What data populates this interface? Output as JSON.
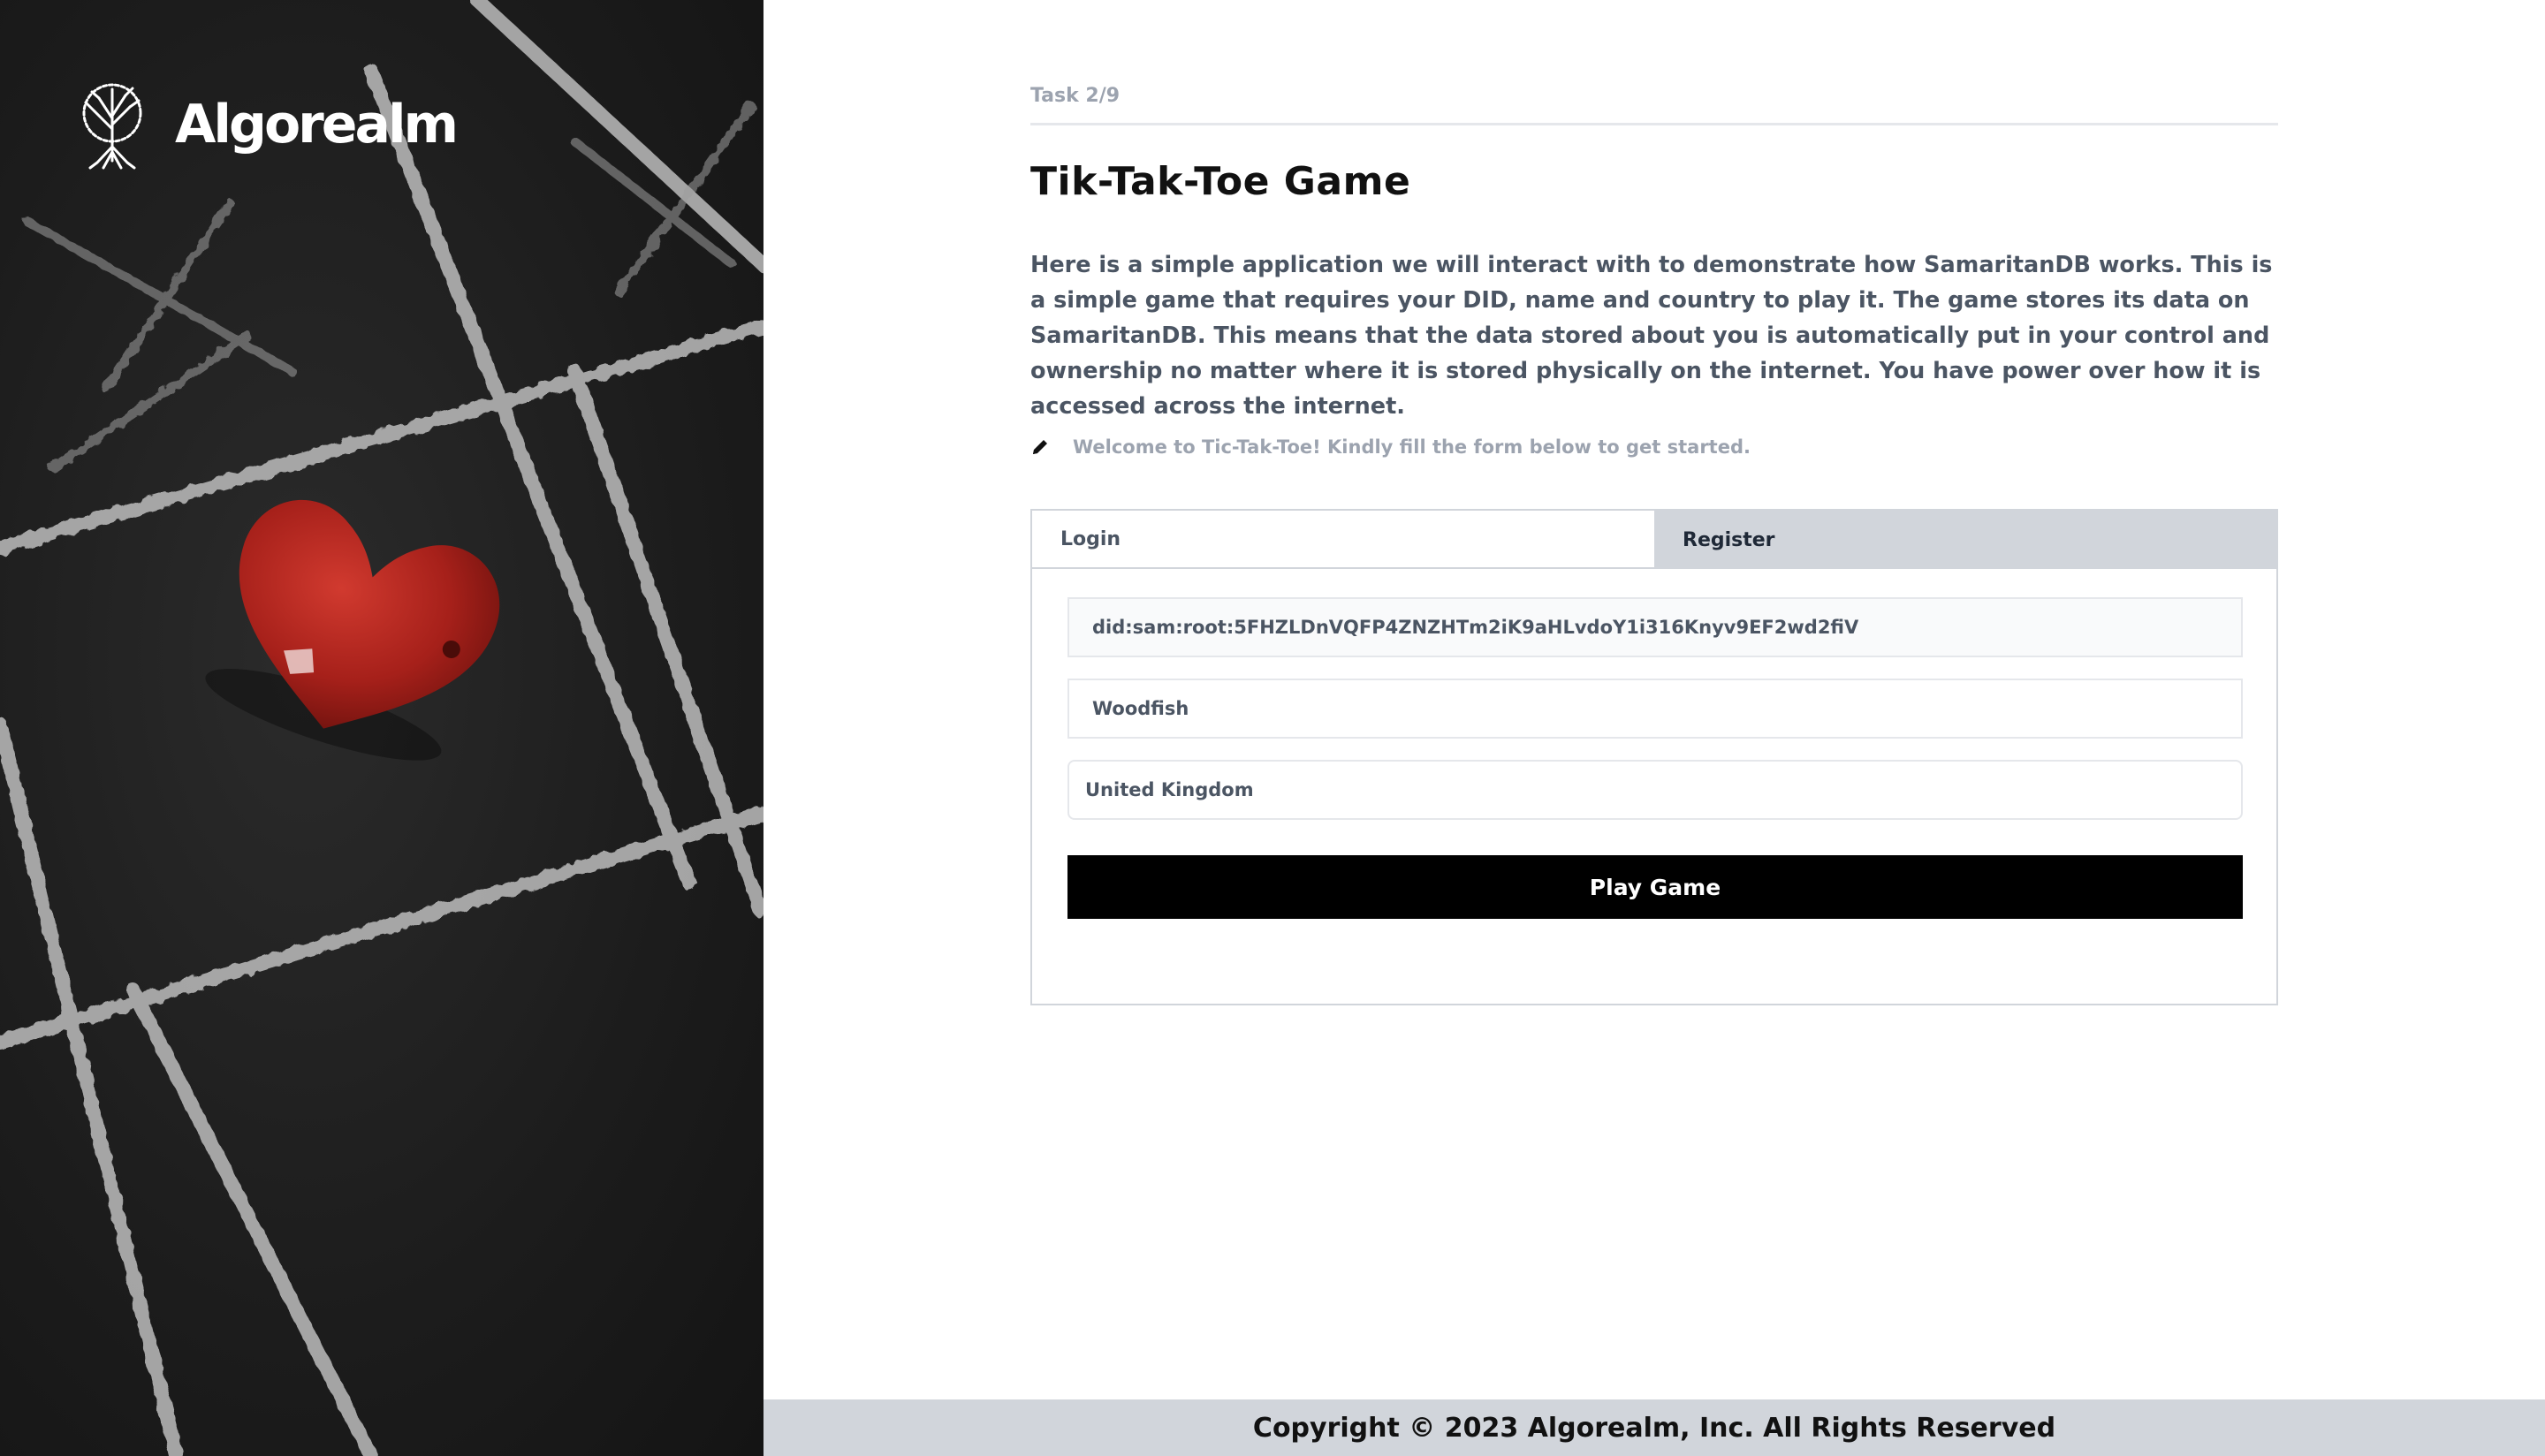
{
  "brand": {
    "name": "Algorealm",
    "logo_icon": "tree-icon"
  },
  "hero": {
    "image": "tic-tac-toe-chalk-board-with-red-heart"
  },
  "task": {
    "label": "Task 2/9"
  },
  "page": {
    "title": "Tik-Tak-Toe Game",
    "description": "Here is a simple application we will interact with to demonstrate how SamaritanDB works. This is a simple game that requires your DID, name and country to play it. The game stores its data on SamaritanDB. This means that the data stored about you is automatically put in your control and ownership no matter where it is stored physically on the internet. You have power over how it is accessed across the internet.",
    "welcome_icon": "pencil-icon",
    "welcome_text": "Welcome to Tic-Tak-Toe! Kindly fill the form below to get started."
  },
  "form": {
    "tabs": [
      {
        "label": "Login",
        "active": true
      },
      {
        "label": "Register",
        "active": false
      }
    ],
    "did_value": "did:sam:root:5FHZLDnVQFP4ZNZHTm2iK9aHLvdoY1i316Knyv9EF2wd2fiV",
    "name_value": "Woodfish",
    "country_value": "United Kingdom",
    "submit_label": "Play Game"
  },
  "footer": {
    "text": "Copyright © 2023 Algorealm, Inc. All Rights Reserved"
  },
  "colors": {
    "hero_bg": "#1c1c1c",
    "heart": "#b3261e",
    "chalk": "#bdbdbd",
    "button_bg": "#000000",
    "tab_inactive_bg": "#d1d5db",
    "footer_bg": "#d1d5db"
  }
}
